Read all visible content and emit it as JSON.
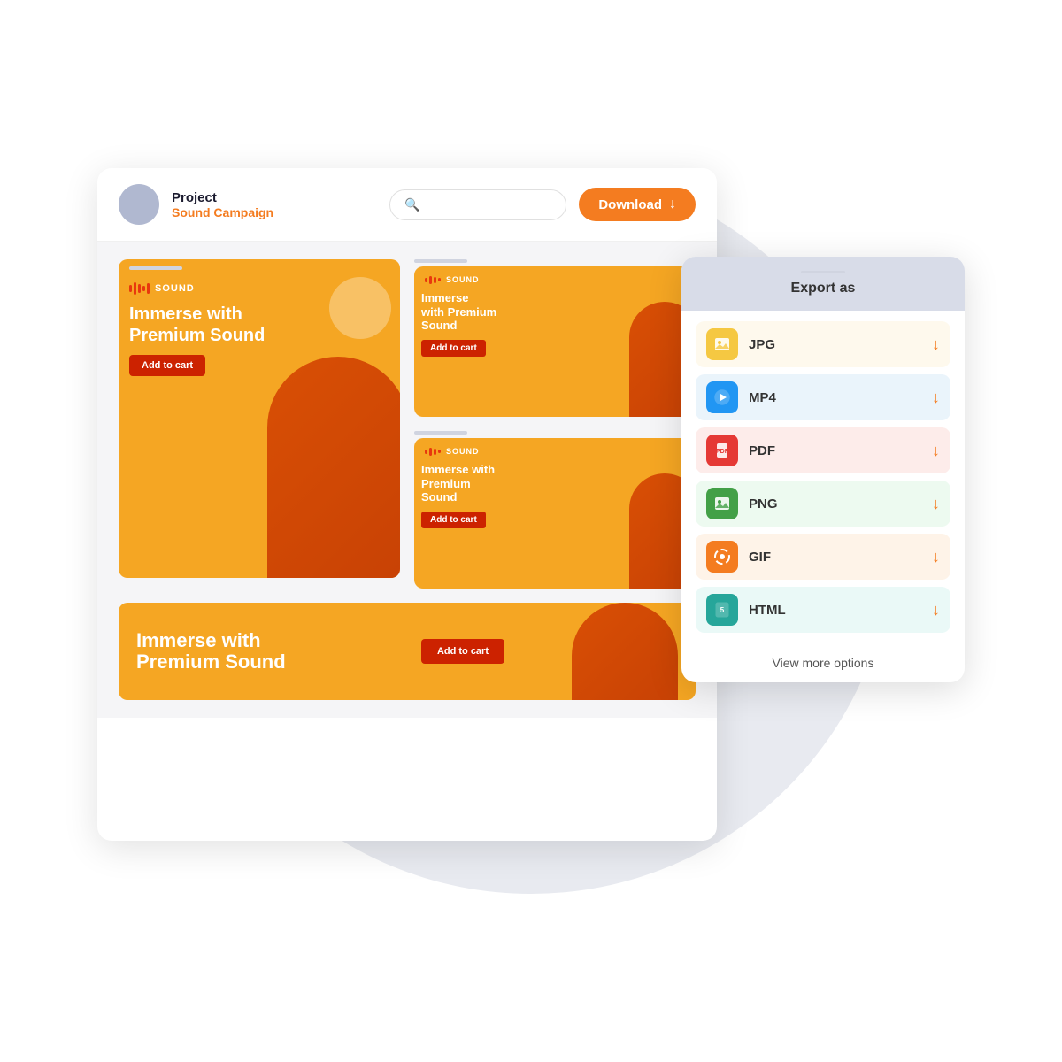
{
  "background_circle": {
    "color": "#e8eaf0"
  },
  "app_card": {
    "header": {
      "project_label": "Project",
      "project_sub": "Sound Campaign",
      "search_placeholder": "",
      "download_button": "Download"
    },
    "ads": [
      {
        "id": "tall",
        "brand": "SOUND",
        "headline": "Immerse with Premium Sound",
        "cta": "Add to cart"
      },
      {
        "id": "medium-top",
        "brand": "SOUND",
        "headline": "Immerse with Premium Sound",
        "cta": "Add to cart"
      },
      {
        "id": "medium-bottom",
        "brand": "SOUND",
        "headline": "Immerse with Premium Sound",
        "cta": "Add to cart"
      },
      {
        "id": "wide",
        "headline": "Immerse with Premium Sound",
        "cta": "Add to cart"
      }
    ]
  },
  "export_panel": {
    "title": "Export as",
    "formats": [
      {
        "id": "jpg",
        "label": "JPG",
        "icon_color": "#f5c842",
        "bg": "#fef9ed",
        "icon_char": "🖼"
      },
      {
        "id": "mp4",
        "label": "MP4",
        "icon_color": "#2196f3",
        "bg": "#eaf4fb",
        "icon_char": "▶"
      },
      {
        "id": "pdf",
        "label": "PDF",
        "icon_color": "#e53935",
        "bg": "#fdecea",
        "icon_char": "📄"
      },
      {
        "id": "png",
        "label": "PNG",
        "icon_color": "#43a047",
        "bg": "#edfaf0",
        "icon_char": "🖼"
      },
      {
        "id": "gif",
        "label": "GIF",
        "icon_color": "#f47c20",
        "bg": "#fef3e8",
        "icon_char": "◑"
      },
      {
        "id": "html",
        "label": "HTML",
        "icon_color": "#26a69a",
        "bg": "#eaf9f7",
        "icon_char": "5"
      }
    ],
    "view_more": "View more options",
    "download_arrow": "↓"
  },
  "colors": {
    "orange": "#f47c20",
    "ad_bg": "#f5a623",
    "red_cta": "#cc2200",
    "accent": "#e8380d"
  }
}
